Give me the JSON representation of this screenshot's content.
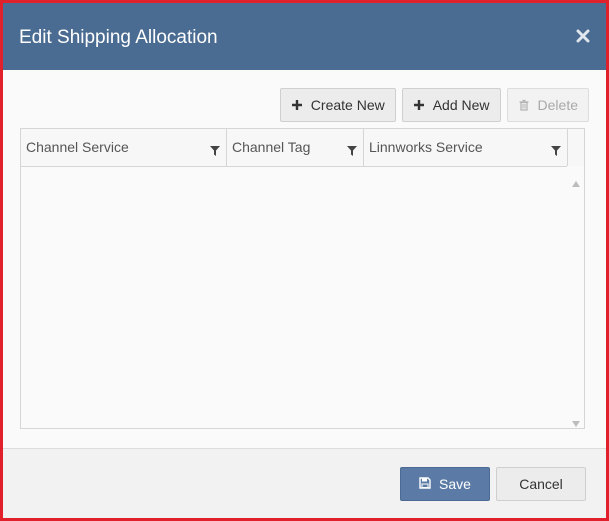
{
  "dialog": {
    "title": "Edit Shipping Allocation",
    "close_icon": "close-icon"
  },
  "toolbar": {
    "create_new_label": "Create New",
    "add_new_label": "Add New",
    "delete_label": "Delete",
    "create_icon": "plus-icon",
    "add_icon": "plus-icon",
    "delete_icon": "trash-icon"
  },
  "grid": {
    "columns": [
      {
        "label": "Channel Service",
        "filter_icon": "filter-icon"
      },
      {
        "label": "Channel Tag",
        "filter_icon": "filter-icon"
      },
      {
        "label": "Linnworks Service",
        "filter_icon": "filter-icon"
      }
    ],
    "rows": []
  },
  "footer": {
    "save_label": "Save",
    "cancel_label": "Cancel",
    "save_icon": "floppy-disk-icon"
  },
  "colors": {
    "header_bg": "#4a6b92",
    "frame_border": "#e0202a",
    "save_bg": "#5b7ba6"
  }
}
